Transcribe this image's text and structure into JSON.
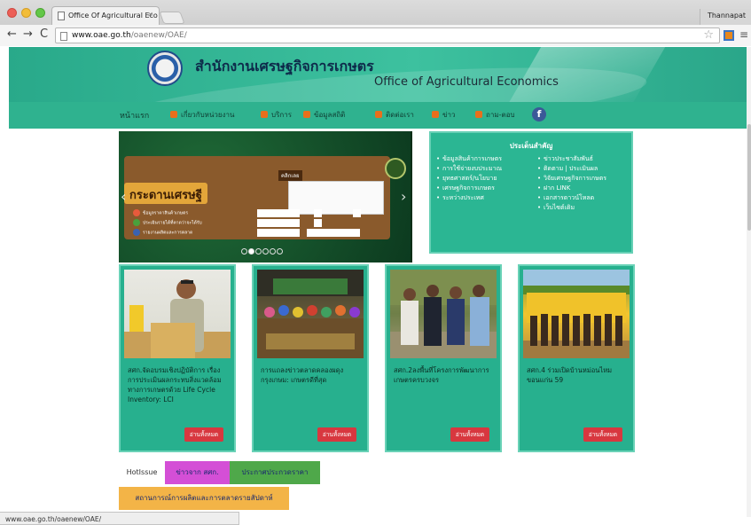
{
  "browser": {
    "tab_title": "Office Of Agricultural Eco",
    "profile_name": "Thannapat",
    "url_host": "www.oae.go.th",
    "url_path": "/oaenew/OAE/",
    "status_url": "www.oae.go.th/oaenew/OAE/"
  },
  "site": {
    "title_th": "สำนักงานเศรษฐกิจการเกษตร",
    "title_en": "Office of Agricultural Economics",
    "accent_color": "#2fb28f"
  },
  "nav": {
    "home": "หน้าแรก",
    "items": [
      "เกี่ยวกับหน่วยงาน",
      "บริการ",
      "ข้อมูลสถิติ",
      "ติดต่อเรา",
      "ข่าว",
      "ถาม-ตอบ"
    ],
    "facebook_icon": "f"
  },
  "slider": {
    "banner": "กระดานเศรษฐี",
    "tag": "คลิกเลย",
    "row1": "ข้อมูลราคาสินค้าเกษตร",
    "row2": "ประเมินรายได้ที่คาดว่าจะได้รับ",
    "row3": "รายงานผลิตและการตลาด"
  },
  "topics": {
    "title": "ประเด็นสำคัญ",
    "left": [
      "ข้อมูลสินค้าการเกษตร",
      "การใช้จ่ายงบประมาณ",
      "ยุทธศาสตร์/นโยบาย",
      "เศรษฐกิจการเกษตร",
      "ระหว่างประเทศ"
    ],
    "right": [
      "ข่าวประชาสัมพันธ์",
      "ติดตาม | ประเมินผล",
      "วิจัยเศรษฐกิจการเกษตร",
      "ฝาก LINK",
      "เอกสารดาวน์โหลด",
      "เว็บไซต์เดิม"
    ]
  },
  "cards": [
    {
      "text": "สศก.จัดอบรมเชิงปฏิบัติการ เรื่อง การประเมินผลกระทบสิ่งแวดล้อมทางการเกษตรด้วย Life Cycle Inventory: LCI",
      "button": "อ่านทั้งหมด"
    },
    {
      "text": "การแถลงข่าวตลาดคลองผดุงกรุงเกษม: เกษตรดีที่สุด",
      "button": "อ่านทั้งหมด"
    },
    {
      "text": "สศก.2ลงพื้นที่โครงการพัฒนาการเกษตรครบวงจร",
      "button": "อ่านทั้งหมด"
    },
    {
      "text": "สศก.4 ร่วมเปิดบ้านหม่อนไหม ขอนแก่น 59",
      "button": "อ่านทั้งหมด"
    }
  ],
  "bottom_tabs": {
    "hotissue": "HotIssue",
    "news": "ข่าวจาก สศก.",
    "announce": "ประกาศประกวดราคา",
    "market": "สถานการณ์การผลิตและการตลาดรายสัปดาห์"
  }
}
